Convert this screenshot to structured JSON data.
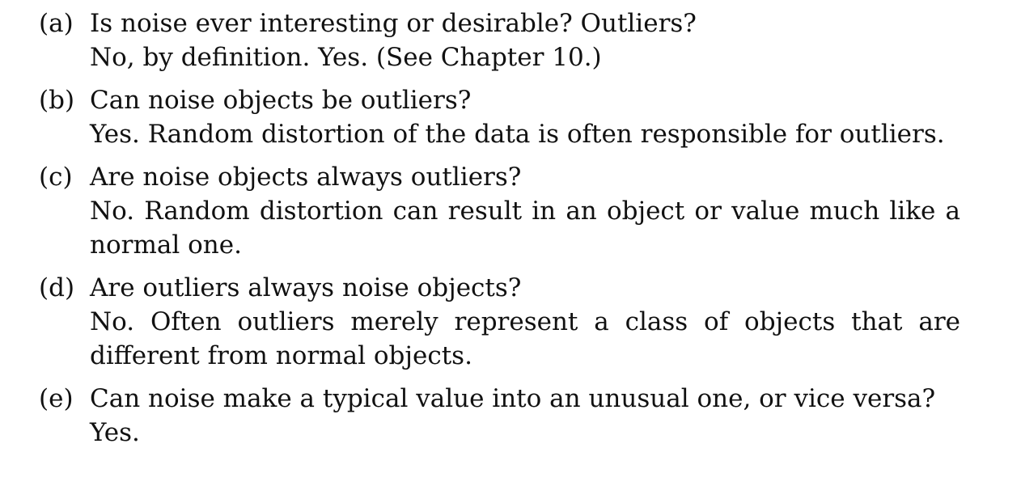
{
  "items": [
    {
      "label": "(a)",
      "question": "Is noise ever interesting or desirable? Outliers?",
      "answer": "No, by definition. Yes. (See Chapter 10.)"
    },
    {
      "label": "(b)",
      "question": "Can noise objects be outliers?",
      "answer": "Yes. Random distortion of the data is often responsible for outliers."
    },
    {
      "label": "(c)",
      "question": "Are noise objects always outliers?",
      "answer": "No. Random distortion can result in an object or value much like a normal one."
    },
    {
      "label": "(d)",
      "question": "Are outliers always noise objects?",
      "answer": "No. Often outliers merely represent a class of objects that are different from normal objects."
    },
    {
      "label": "(e)",
      "question": "Can noise make a typical value into an unusual one, or vice versa?",
      "answer": "Yes."
    }
  ]
}
